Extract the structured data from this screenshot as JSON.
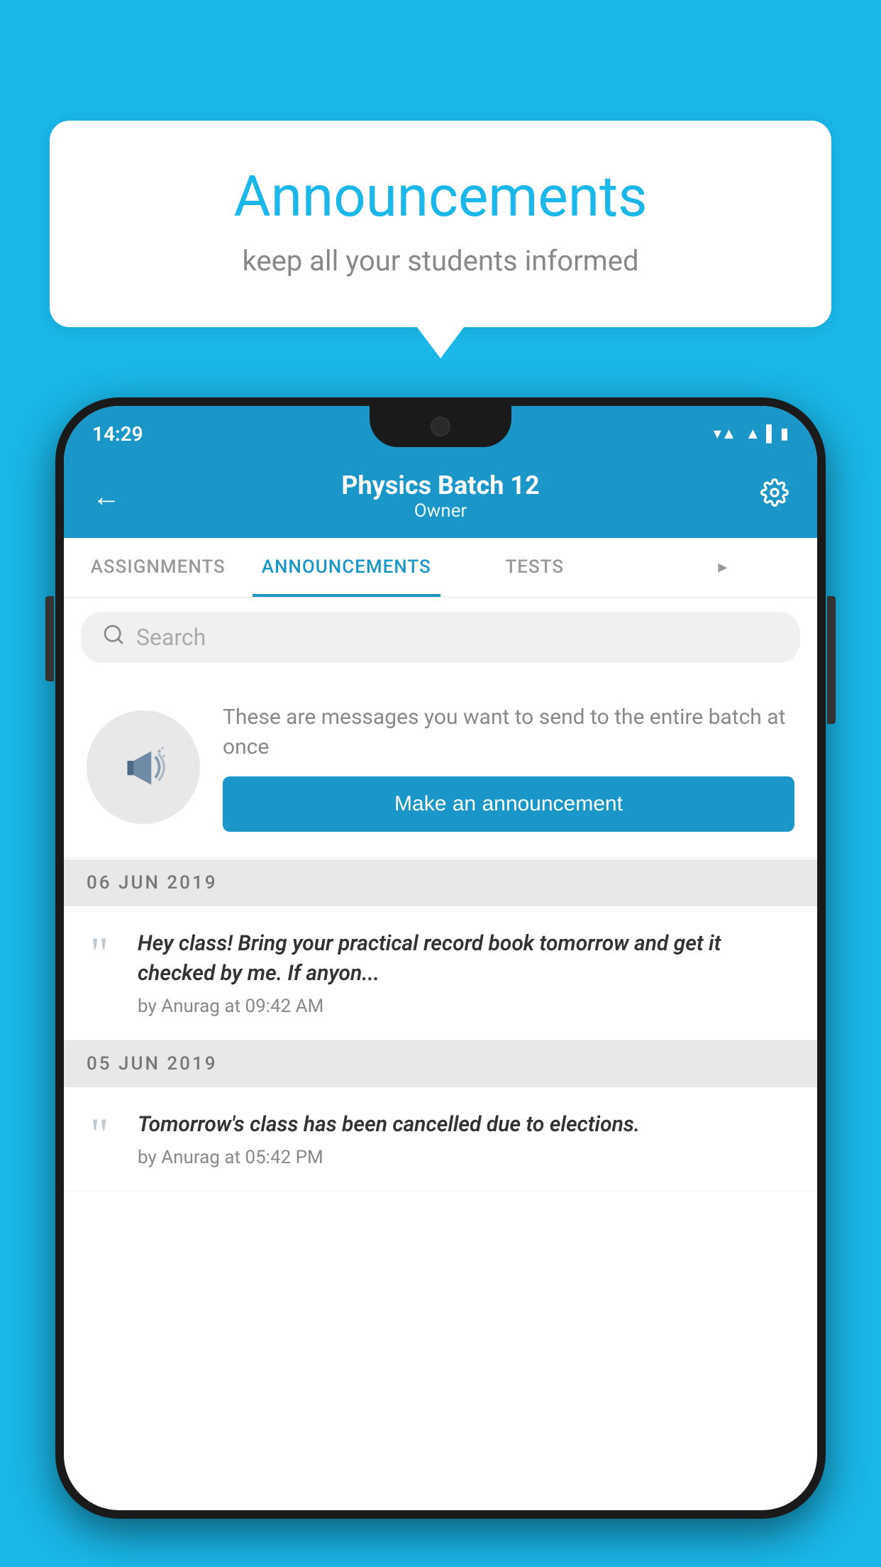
{
  "background_color": "#1ab7e8",
  "speech_bubble": {
    "title": "Announcements",
    "subtitle": "keep all your students informed"
  },
  "phone": {
    "status_bar": {
      "time": "14:29",
      "wifi": "▼▲",
      "signal": "▲",
      "battery": "▮"
    },
    "header": {
      "back_label": "←",
      "title": "Physics Batch 12",
      "subtitle": "Owner",
      "gear_label": "⚙"
    },
    "tabs": [
      {
        "label": "ASSIGNMENTS",
        "active": false
      },
      {
        "label": "ANNOUNCEMENTS",
        "active": true
      },
      {
        "label": "TESTS",
        "active": false
      },
      {
        "label": "▸",
        "active": false
      }
    ],
    "search": {
      "placeholder": "Search"
    },
    "announcement_intro": {
      "description": "These are messages you want to\nsend to the entire batch at once",
      "button_label": "Make an announcement"
    },
    "date_groups": [
      {
        "date": "06  JUN  2019",
        "items": [
          {
            "text": "Hey class! Bring your practical record book tomorrow and get it checked by me. If anyon...",
            "meta": "by Anurag at 09:42 AM"
          }
        ]
      },
      {
        "date": "05  JUN  2019",
        "items": [
          {
            "text": "Tomorrow's class has been cancelled due to elections.",
            "meta": "by Anurag at 05:42 PM"
          }
        ]
      }
    ]
  }
}
